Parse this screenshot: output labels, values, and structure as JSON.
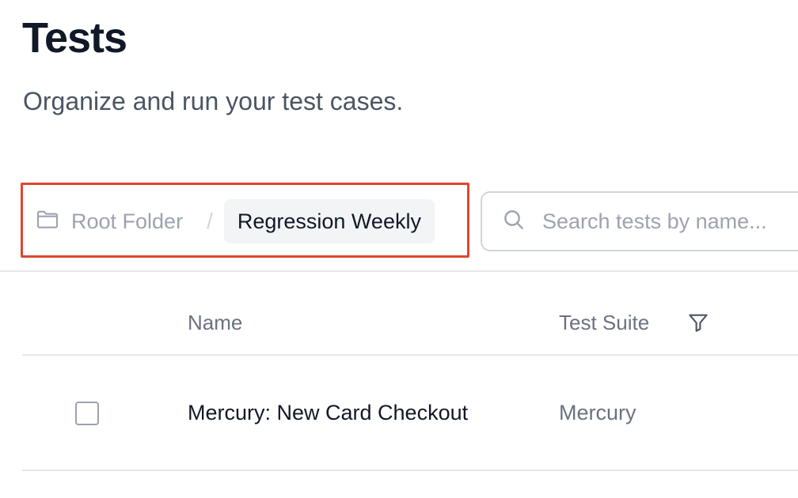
{
  "header": {
    "title": "Tests",
    "subtitle": "Organize and run your test cases."
  },
  "breadcrumb": {
    "root_label": "Root Folder",
    "separator": "/",
    "current_label": "Regression Weekly"
  },
  "search": {
    "placeholder": "Search tests by name..."
  },
  "table": {
    "columns": [
      "Name",
      "Test Suite"
    ],
    "rows": [
      {
        "name": "Mercury: New Card Checkout",
        "suite": "Mercury",
        "checked": false
      }
    ]
  },
  "colors": {
    "highlight_border": "#e0452f",
    "title": "#111827",
    "muted": "#6b7280"
  },
  "icons": {
    "root": "folder-icon",
    "search": "search-icon",
    "filter": "filter-icon"
  }
}
